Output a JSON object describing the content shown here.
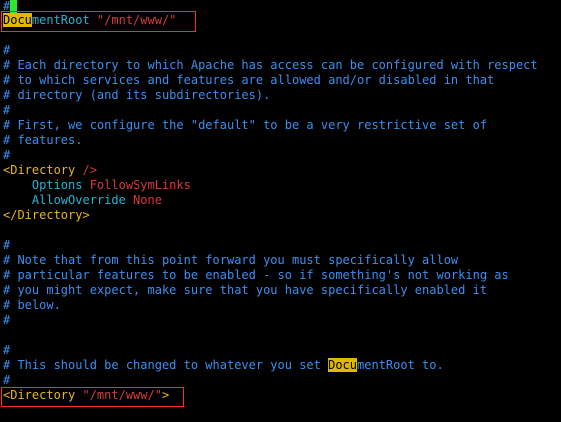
{
  "editor": {
    "cursor_line": {
      "hash": "#"
    },
    "lines": {
      "l1": {
        "hl": "Docu",
        "rest": "mentRoot",
        "value": " \"/mnt/www/\""
      },
      "l2": "#",
      "l3": "# Each directory to which Apache has access can be configured with respect",
      "l4": "# to which services and features are allowed and/or disabled in that",
      "l5": "# directory (and its subdirectories).",
      "l6": "#",
      "l7": "# First, we configure the \"default\" to be a very restrictive set of",
      "l8": "# features.",
      "l9": "#",
      "l10": {
        "open": "<Directory",
        "value": " />",
        "close": ""
      },
      "l11": {
        "indent": "    ",
        "key": "Options",
        "value": " FollowSymLinks"
      },
      "l12": {
        "indent": "    ",
        "key": "AllowOverride",
        "value": " None"
      },
      "l13": "</Directory>",
      "l14": "#",
      "l15": "# Note that from this point forward you must specifically allow",
      "l16": "# particular features to be enabled - so if something's not working as",
      "l17": "# you might expect, make sure that you have specifically enabled it",
      "l18": "# below.",
      "l19": "#",
      "l20": "#",
      "l21": {
        "pre": "# This should be changed to whatever you set ",
        "hl": "Docu",
        "post": "mentRoot to."
      },
      "l22": "#",
      "l23": {
        "open": "<Directory",
        "value": " \"/mnt/www/\"",
        "close": ">"
      }
    },
    "colors": {
      "background": "#000000",
      "comment": "#3b8ef0",
      "tag": "#e6b422",
      "directive": "#1fb5d6",
      "value": "#d43a3a",
      "search_highlight": "#e0b800",
      "cursor": "#2ee82e",
      "annotation_box": "#ff2a2a"
    }
  }
}
